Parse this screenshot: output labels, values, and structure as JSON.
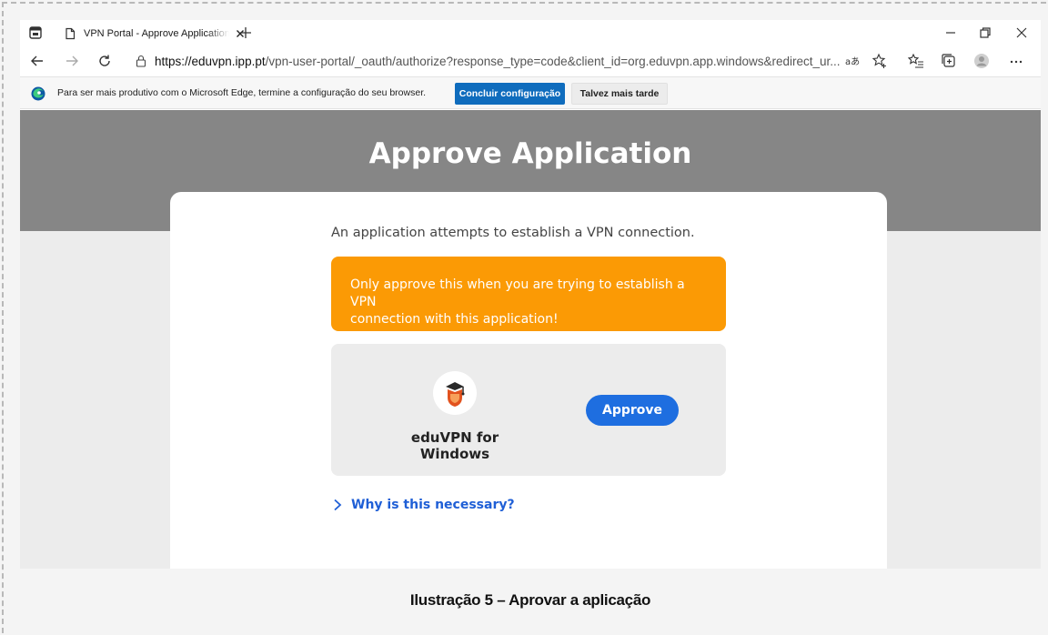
{
  "browser": {
    "tab_title": "VPN Portal - Approve Application",
    "url_host": "https://eduvpn.ipp.pt",
    "url_path": "/vpn-user-portal/_oauth/authorize?response_type=code&client_id=org.eduvpn.app.windows&redirect_ur...",
    "infobar_message": "Para ser mais produtivo com o Microsoft Edge, termine a configuração do seu browser.",
    "infobar_primary": "Concluir configuração",
    "infobar_secondary": "Talvez mais tarde"
  },
  "page": {
    "title": "Approve Application",
    "intro": "An application attempts to establish a VPN connection.",
    "warning_line1": "Only approve this when you are trying to establish a VPN",
    "warning_line2": "connection with this application!",
    "app_name": "eduVPN for Windows",
    "approve_label": "Approve",
    "why_link": "Why is this necessary?"
  },
  "caption": "Ilustração 5 – Aprovar a aplicação",
  "colors": {
    "banner": "#868686",
    "warning": "#fb9a05",
    "approve_button": "#1e6ee0",
    "link": "#1f5fd6",
    "edge_primary": "#0f6cbd"
  },
  "icons": {
    "app_logo": "eduvpn-logo-icon",
    "why_toggle": "chevron-right-icon"
  }
}
